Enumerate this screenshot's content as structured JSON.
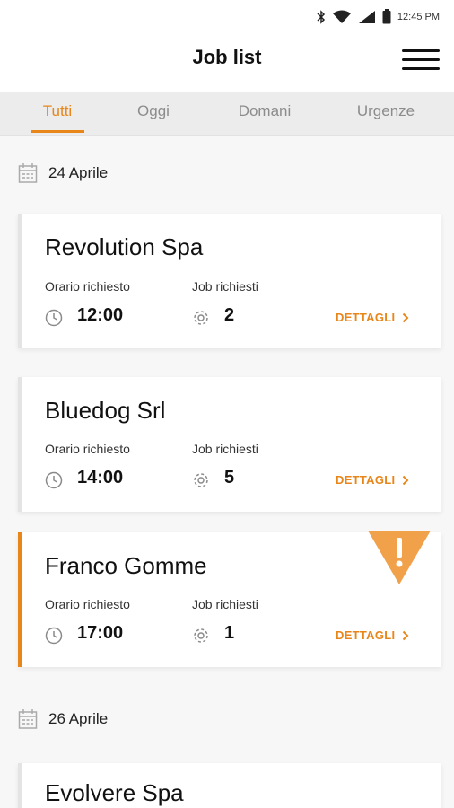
{
  "status_bar": {
    "time": "12:45 PM",
    "icons": [
      "bluetooth-icon",
      "wifi-icon",
      "cellular-signal-icon",
      "battery-icon"
    ]
  },
  "header": {
    "title": "Job list",
    "menu_icon": "hamburger-menu-icon"
  },
  "tabs": [
    {
      "label": "Tutti",
      "active": true
    },
    {
      "label": "Oggi",
      "active": false
    },
    {
      "label": "Domani",
      "active": false
    },
    {
      "label": "Urgenze",
      "active": false
    }
  ],
  "colors": {
    "accent": "#e8861a",
    "tab_bar": "#ececec",
    "background": "#f7f7f7"
  },
  "groups": [
    {
      "date": "24 Aprile",
      "jobs": [
        {
          "company": "Revolution Spa",
          "time_label": "Orario richiesto",
          "time": "12:00",
          "jobs_label": "Job richiesti",
          "jobs_count": "2",
          "details_label": "DETTAGLI",
          "urgent": false
        },
        {
          "company": "Bluedog Srl",
          "time_label": "Orario richiesto",
          "time": "14:00",
          "jobs_label": "Job richiesti",
          "jobs_count": "5",
          "details_label": "DETTAGLI",
          "urgent": false
        },
        {
          "company": "Franco Gomme",
          "time_label": "Orario richiesto",
          "time": "17:00",
          "jobs_label": "Job richiesti",
          "jobs_count": "1",
          "details_label": "DETTAGLI",
          "urgent": true
        }
      ]
    },
    {
      "date": "26 Aprile",
      "jobs": [
        {
          "company": "Evolvere Spa",
          "urgent": false
        }
      ]
    }
  ]
}
